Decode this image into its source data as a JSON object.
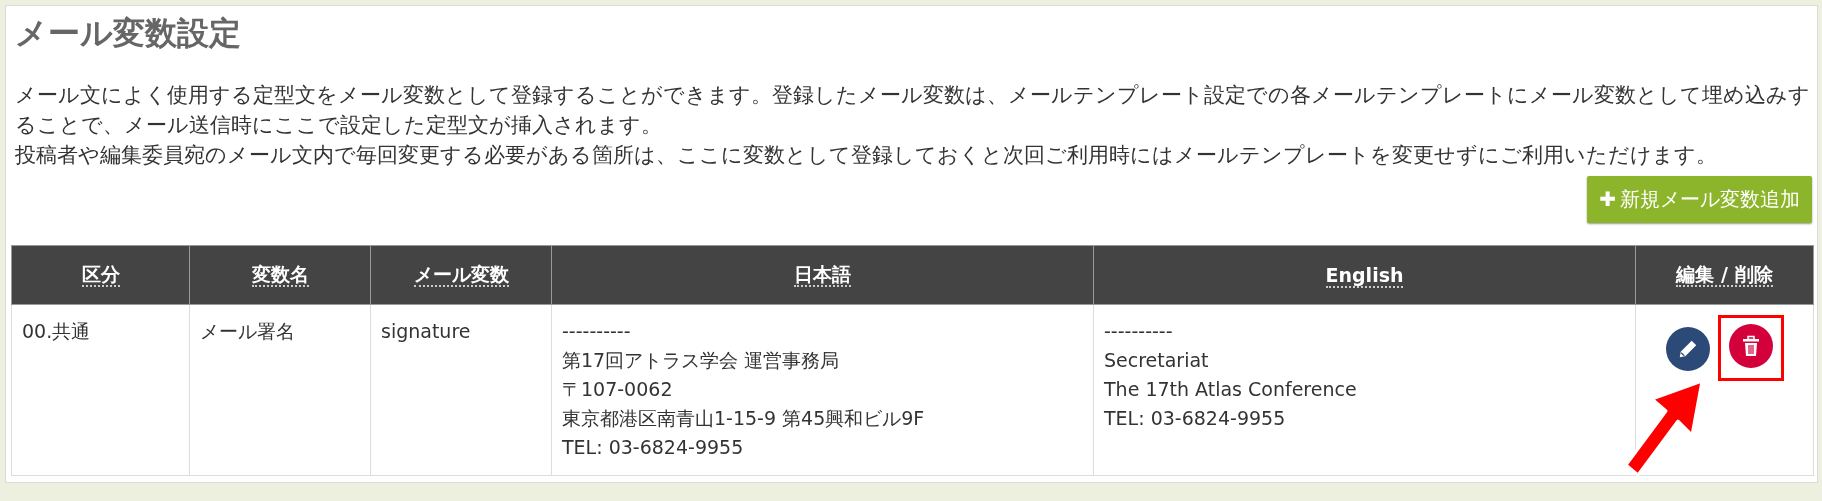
{
  "title": "メール変数設定",
  "description": [
    "メール文によく使用する定型文をメール変数として登録することができます。登録したメール変数は、メールテンプレート設定での各メールテンプレートにメール変数として埋め込みすることで、メール送信時にここで設定した定型文が挿入されます。",
    "投稿者や編集委員宛のメール文内で毎回変更する必要がある箇所は、ここに変数として登録しておくと次回ご利用時にはメールテンプレートを変更せずにご利用いただけます。"
  ],
  "add_button": {
    "icon": "✚",
    "label": "新規メール変数追加"
  },
  "table": {
    "columns": [
      "区分",
      "変数名",
      "メール変数",
      "日本語",
      "English",
      "編集 / 削除"
    ],
    "rows": [
      {
        "cells": [
          [
            "00.共通"
          ],
          [
            "メール署名"
          ],
          [
            "signature"
          ],
          [
            "----------",
            "第17回アトラス学会 運営事務局",
            "〒107-0062",
            "東京都港区南青山1-15-9 第45興和ビル9F",
            "TEL: 03-6824-9955"
          ],
          [
            "----------",
            "Secretariat",
            "The 17th Atlas Conference",
            "TEL: 03-6824-9955"
          ]
        ],
        "actions": [
          {
            "kind": "edit"
          },
          {
            "kind": "delete"
          }
        ]
      }
    ]
  }
}
